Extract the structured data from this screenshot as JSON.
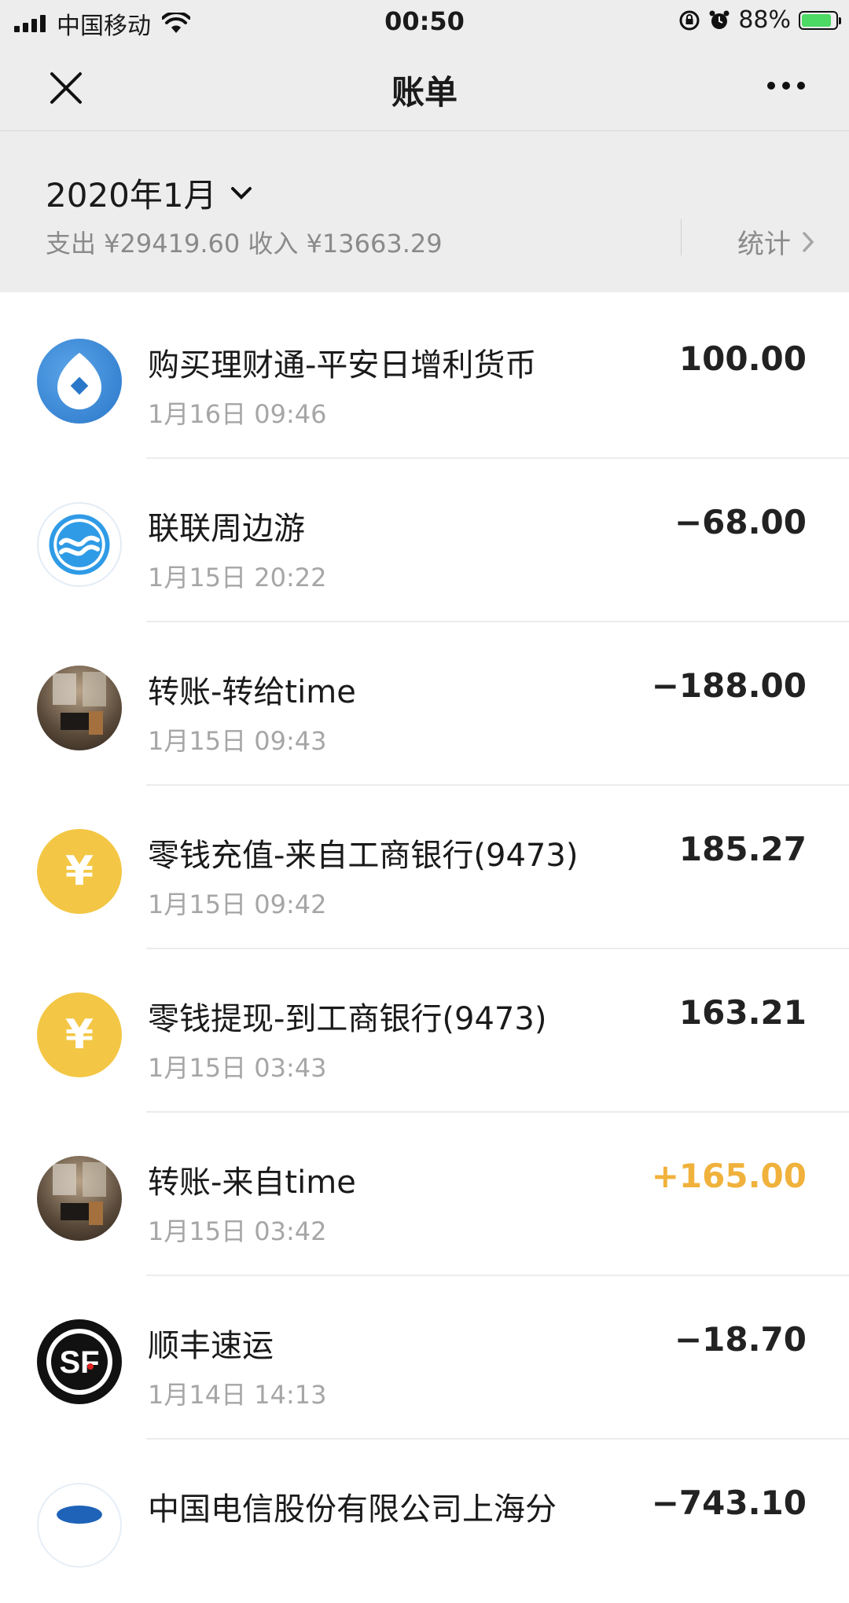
{
  "status_bar": {
    "carrier": "中国移动",
    "time": "00:50",
    "battery": "88%",
    "battery_level": 0.88,
    "icons": [
      "signal-icon",
      "wifi-icon",
      "orientation-lock-icon",
      "alarm-icon",
      "battery-icon"
    ]
  },
  "nav": {
    "title": "账单",
    "close_icon": "close-icon",
    "more_icon": "more-icon"
  },
  "summary": {
    "month": "2020年1月",
    "totals": "支出 ¥29419.60 收入 ¥13663.29",
    "stats_label": "统计"
  },
  "transactions": [
    {
      "title": "购买理财通-平安日增利货币",
      "time": "1月16日 09:46",
      "amount": "100.00",
      "icon": "licaitong-icon"
    },
    {
      "title": "联联周边游",
      "time": "1月15日 20:22",
      "amount": "−68.00",
      "icon": "lianlian-icon"
    },
    {
      "title": "转账-转给time",
      "time": "1月15日 09:43",
      "amount": "−188.00",
      "icon": "user-avatar"
    },
    {
      "title": "零钱充值-来自工商银行(9473)",
      "time": "1月15日 09:42",
      "amount": "185.27",
      "icon": "yuan-coin-icon",
      "coin_symbol": "¥"
    },
    {
      "title": "零钱提现-到工商银行(9473)",
      "time": "1月15日 03:43",
      "amount": "163.21",
      "icon": "yuan-coin-icon",
      "coin_symbol": "¥"
    },
    {
      "title": "转账-来自time",
      "time": "1月15日 03:42",
      "amount": "+165.00",
      "icon": "user-avatar"
    },
    {
      "title": "顺丰速运",
      "time": "1月14日 14:13",
      "amount": "−18.70",
      "icon": "sf-express-icon"
    },
    {
      "title": "中国电信股份有限公司上海分",
      "time": "",
      "amount": "−743.10",
      "icon": "china-telecom-icon"
    }
  ],
  "colors": {
    "header_bg": "#ededed",
    "income_amount": "#f0b23c",
    "coin_yellow": "#f3c745"
  }
}
